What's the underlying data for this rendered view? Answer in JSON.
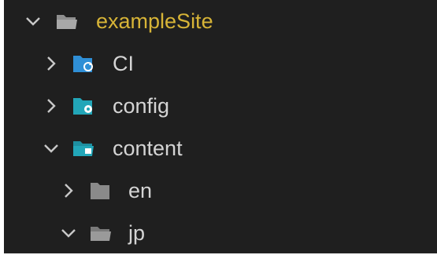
{
  "tree": {
    "root": {
      "label": "exampleSite",
      "expanded": true,
      "icon": "folder-open-icon",
      "color": "#d7b437"
    },
    "items": [
      {
        "label": "CI",
        "expanded": false,
        "icon": "folder-ci-icon",
        "icon_color": "#2f8fd6"
      },
      {
        "label": "config",
        "expanded": false,
        "icon": "folder-config-icon",
        "icon_color": "#22a6b8"
      },
      {
        "label": "content",
        "expanded": true,
        "icon": "folder-content-icon",
        "icon_color": "#22a6b8"
      },
      {
        "label": "en",
        "expanded": false,
        "icon": "folder-closed-icon",
        "icon_color": "#8a8a8a"
      },
      {
        "label": "jp",
        "expanded": true,
        "icon": "folder-open-icon",
        "icon_color": "#8a8a8a"
      }
    ]
  },
  "colors": {
    "background": "#1f1f1f",
    "text": "#d4d4d4",
    "chevron": "#c8c8c8"
  }
}
